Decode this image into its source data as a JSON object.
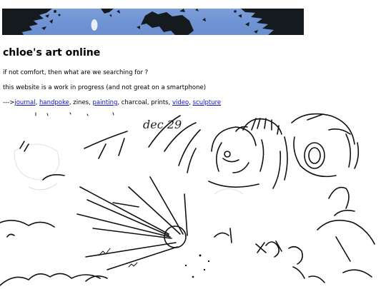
{
  "banner": {
    "alt": "tree branches against a blue sky with the moon"
  },
  "header": {
    "title": "chloe's art online"
  },
  "intro": {
    "tagline": "if not comfort, then what are we searching for ?",
    "notice": "this website is a work in progress (and not great on a smartphone)"
  },
  "nav": {
    "prefix": "--->",
    "items": [
      {
        "label": "journal",
        "link": true
      },
      {
        "label": ", ",
        "link": false
      },
      {
        "label": "handpoke",
        "link": true
      },
      {
        "label": ", zines, ",
        "link": false
      },
      {
        "label": "painting",
        "link": true
      },
      {
        "label": ", charcoal, prints, ",
        "link": false
      },
      {
        "label": "video",
        "link": true
      },
      {
        "label": ", ",
        "link": false
      },
      {
        "label": "sculpture",
        "link": true
      }
    ],
    "link_color": "#1010d0"
  },
  "drawing": {
    "date_label": "dec 29"
  },
  "colors": {
    "sky": "#6f93d4",
    "ink": "#111111"
  }
}
